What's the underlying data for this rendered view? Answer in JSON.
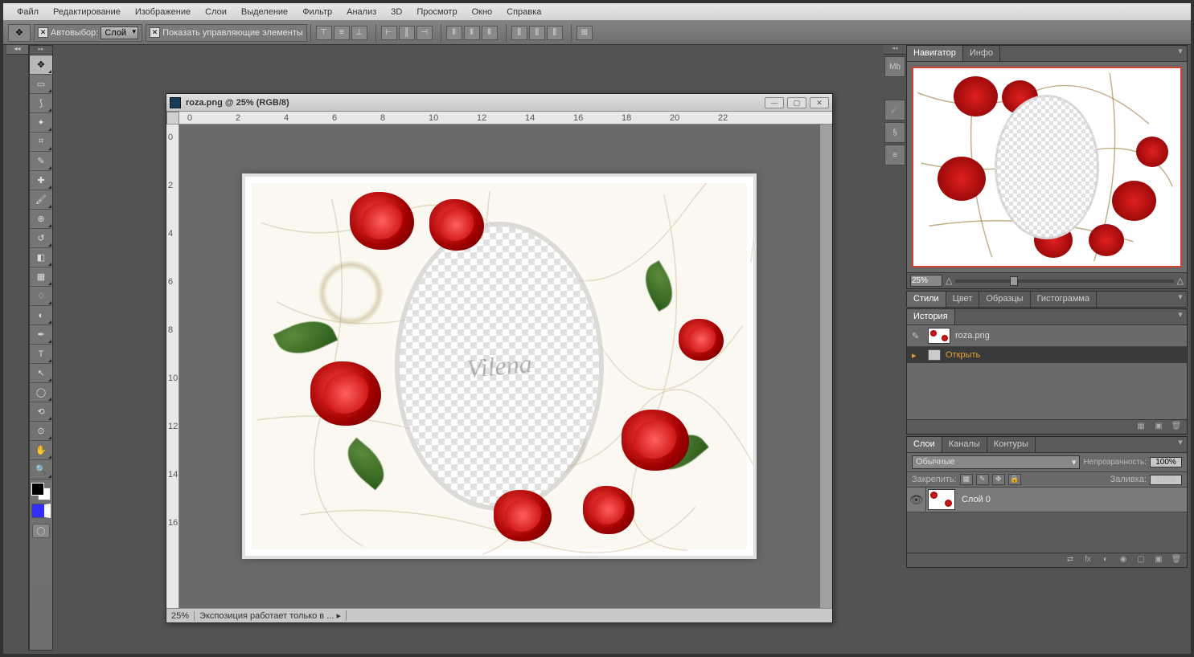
{
  "menu": {
    "file": "Файл",
    "edit": "Редактирование",
    "image": "Изображение",
    "layer": "Слои",
    "select": "Выделение",
    "filter": "Фильтр",
    "analysis": "Анализ",
    "three_d": "3D",
    "view": "Просмотр",
    "window": "Окно",
    "help": "Справка"
  },
  "options": {
    "autoselect": "Автовыбор:",
    "autoselect_value": "Слой",
    "show_transform": "Показать управляющие элементы"
  },
  "document": {
    "title": "roza.png @ 25% (RGB/8)",
    "zoom": "25%",
    "status": "Экспозиция работает только в ...",
    "watermark": "Vilena",
    "ruler_marks_h": [
      "0",
      "2",
      "4",
      "6",
      "8",
      "10",
      "12",
      "14",
      "16",
      "18",
      "20",
      "22"
    ],
    "ruler_marks_v": [
      "0",
      "2",
      "4",
      "6",
      "8",
      "10",
      "12",
      "14",
      "16"
    ]
  },
  "panels": {
    "navigator": {
      "tab1": "Навигатор",
      "tab2": "Инфо",
      "zoom": "25%"
    },
    "color": {
      "tab1": "Стили",
      "tab2": "Цвет",
      "tab3": "Образцы",
      "tab4": "Гистограмма"
    },
    "history": {
      "tab": "История",
      "doc": "roza.png",
      "step1": "Открыть"
    },
    "layers": {
      "tab1": "Слои",
      "tab2": "Каналы",
      "tab3": "Контуры",
      "blend_mode": "Обычные",
      "opacity_label": "Непрозрачность:",
      "opacity": "100%",
      "lock_label": "Закрепить:",
      "fill_label": "Заливка:",
      "fill": "100%",
      "layer0": "Слой 0"
    }
  },
  "tools": [
    "move",
    "marquee",
    "lasso",
    "wand",
    "crop",
    "eyedrop",
    "heal",
    "brush",
    "stamp",
    "history-brush",
    "eraser",
    "gradient",
    "blur",
    "dodge",
    "pen",
    "type",
    "path-sel",
    "shape",
    "3d-rotate",
    "3d-orbit",
    "hand",
    "zoom"
  ]
}
